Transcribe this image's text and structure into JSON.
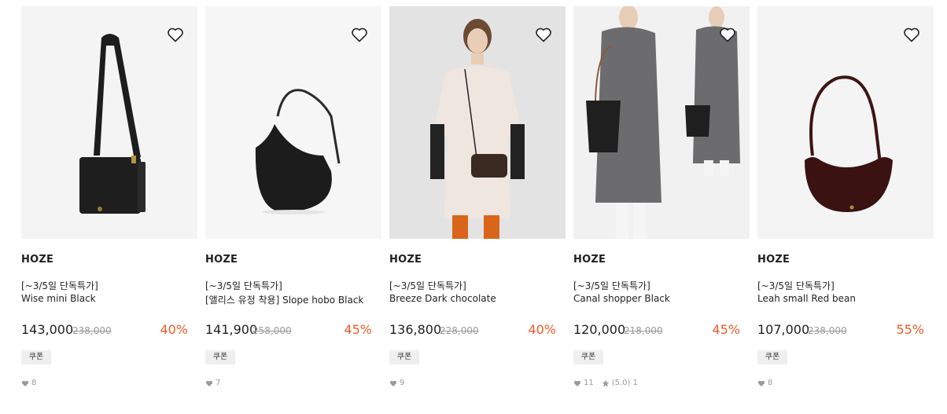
{
  "products": [
    {
      "brand": "HOZE",
      "promo": "[~3/5일 단독특가]",
      "name": "Wise mini Black",
      "price": "143,000",
      "original_price": "238,000",
      "discount": "40%",
      "coupon": "쿠폰",
      "likes": "8",
      "image_icon": "bag-photo"
    },
    {
      "brand": "HOZE",
      "promo": "[~3/5일 단독특가]",
      "name": "[앨리스 유정 착용] Slope hobo Black",
      "price": "141,900",
      "original_price": "258,000",
      "discount": "45%",
      "coupon": "쿠폰",
      "likes": "7",
      "image_icon": "bag-photo"
    },
    {
      "brand": "HOZE",
      "promo": "[~3/5일 단독특가]",
      "name": "Breeze Dark chocolate",
      "price": "136,800",
      "original_price": "228,000",
      "discount": "40%",
      "coupon": "쿠폰",
      "likes": "9",
      "image_icon": "model-photo"
    },
    {
      "brand": "HOZE",
      "promo": "[~3/5일 단독특가]",
      "name": "Canal shopper Black",
      "price": "120,000",
      "original_price": "218,000",
      "discount": "45%",
      "coupon": "쿠폰",
      "likes": "11",
      "rating": "(5.0)",
      "reviews": "1",
      "image_icon": "model-photo"
    },
    {
      "brand": "HOZE",
      "promo": "[~3/5일 단독특가]",
      "name": "Leah small Red bean",
      "price": "107,000",
      "original_price": "238,000",
      "discount": "55%",
      "coupon": "쿠폰",
      "likes": "8",
      "image_icon": "bag-photo"
    }
  ],
  "colors": {
    "discount": "#f05a28",
    "strike": "#9a9a9a",
    "coupon_bg": "#efefef"
  }
}
